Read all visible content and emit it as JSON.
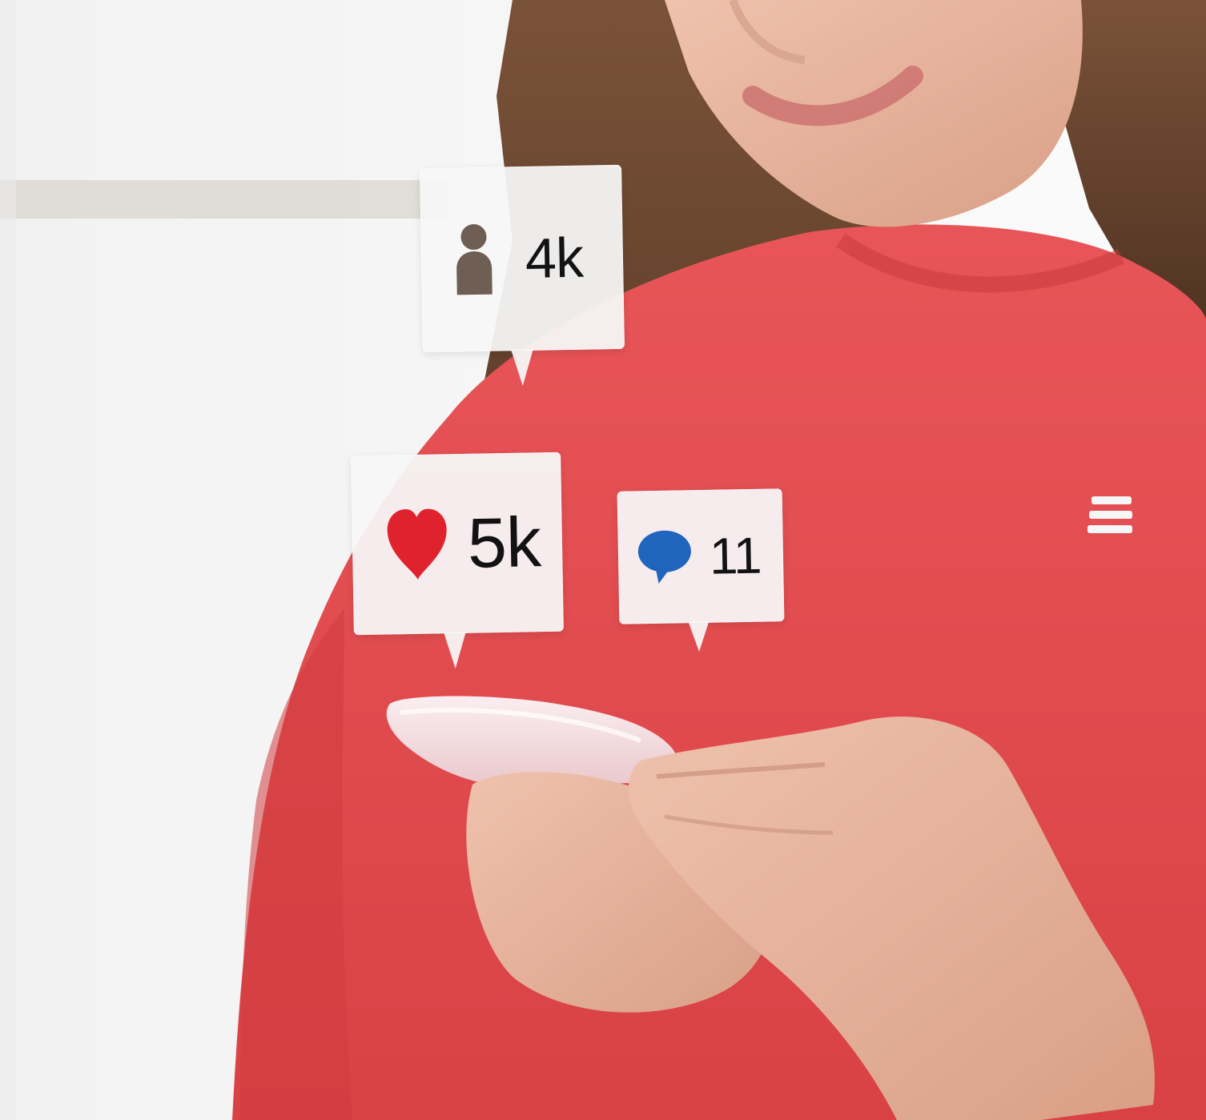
{
  "notifications": {
    "followers": {
      "icon": "person-icon",
      "count": "4k",
      "icon_color": "#6e5e54"
    },
    "likes": {
      "icon": "heart-icon",
      "count": "5k",
      "icon_color": "#e0222e"
    },
    "comments": {
      "icon": "speech-bubble-icon",
      "count": "11",
      "icon_color": "#1f64bd"
    }
  },
  "colors": {
    "sweater": "#e14c4f",
    "skin": "#e7b39c",
    "hair": "#6a4530",
    "phone": "#f3d9dc",
    "background": "#f7f7f7"
  }
}
